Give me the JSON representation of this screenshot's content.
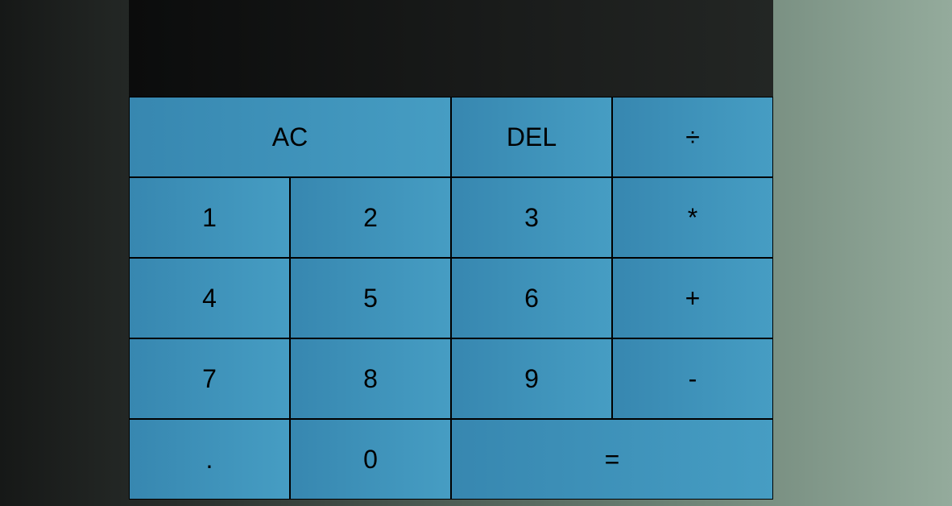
{
  "display": {
    "previous_operand": "",
    "current_operand": ""
  },
  "keys": {
    "all_clear": "AC",
    "delete": "DEL",
    "divide": "÷",
    "one": "1",
    "two": "2",
    "three": "3",
    "multiply": "*",
    "four": "4",
    "five": "5",
    "six": "6",
    "add": "+",
    "seven": "7",
    "eight": "8",
    "nine": "9",
    "subtract": "-",
    "decimal": ".",
    "zero": "0",
    "equals": "="
  },
  "colors": {
    "key_gradient_start": "#3787b0",
    "key_gradient_end": "#469dc3",
    "display_background": "#111312"
  }
}
